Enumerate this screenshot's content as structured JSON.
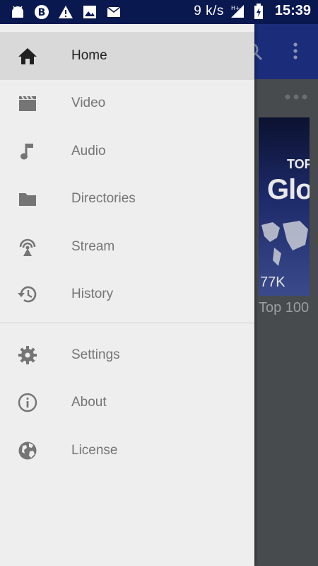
{
  "status_bar": {
    "speed": "9 k/s",
    "time": "15:39",
    "icons": [
      "android-icon",
      "b-badge-icon",
      "warning-icon",
      "image-icon",
      "mail-icon",
      "signal-icon",
      "battery-icon"
    ]
  },
  "drawer": {
    "primary_items": [
      {
        "label": "Home",
        "icon": "home-icon",
        "active": true
      },
      {
        "label": "Video",
        "icon": "movie-clapper-icon",
        "active": false
      },
      {
        "label": "Audio",
        "icon": "music-note-icon",
        "active": false
      },
      {
        "label": "Directories",
        "icon": "folder-icon",
        "active": false
      },
      {
        "label": "Stream",
        "icon": "broadcast-icon",
        "active": false
      },
      {
        "label": "History",
        "icon": "history-icon",
        "active": false
      }
    ],
    "secondary_items": [
      {
        "label": "Settings",
        "icon": "gear-icon"
      },
      {
        "label": "About",
        "icon": "info-icon"
      },
      {
        "label": "License",
        "icon": "globe-icon"
      }
    ]
  },
  "background": {
    "thumb_small_text": "TOF",
    "thumb_large_text": "Glo",
    "thumb_views": "77K",
    "thumb_title": "Top 100"
  },
  "colors": {
    "status_bar": "#0a1850",
    "app_bar": "#1b2d7a",
    "drawer_bg": "#eeeeee",
    "active_item_bg": "#d9d9d9",
    "icon_gray": "#757575"
  }
}
